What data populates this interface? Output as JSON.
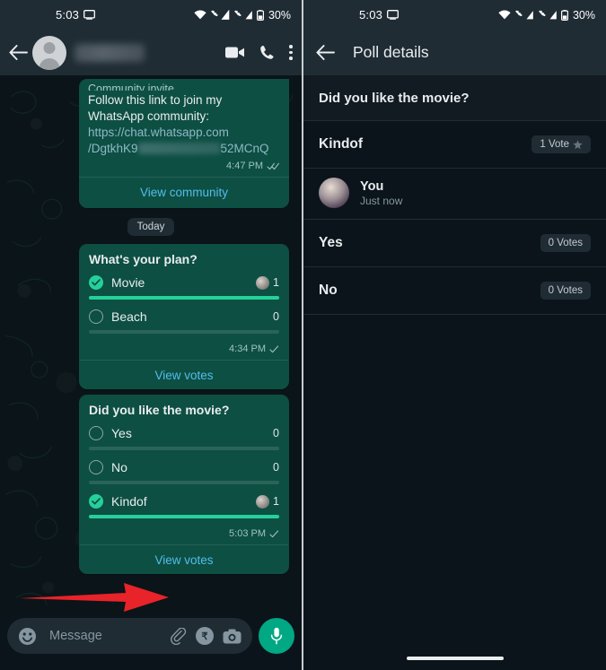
{
  "statusbar": {
    "time": "5:03",
    "battery_percent": "30%",
    "icons": [
      "screencast-icon",
      "wifi-icon",
      "cellular-signal-icon",
      "cellular-signal-icon",
      "battery-icon"
    ]
  },
  "left_panel": {
    "header": {
      "back_icon": "back-arrow-icon",
      "avatar": "contact-avatar",
      "contact_name": "",
      "actions": [
        "video-call-icon",
        "voice-call-icon",
        "overflow-menu-icon"
      ]
    },
    "messages": [
      {
        "type": "community_invite",
        "label": "Community invite",
        "text_line1": "Follow this link to join my",
        "text_line2": "WhatsApp community:",
        "link_line1": "https://chat.whatsapp.com",
        "link_line2_prefix": "/DgtkhK9",
        "link_line2_suffix": "52MCnQ",
        "time": "4:47 PM",
        "status": "read-receipt-double-check",
        "action": "View community"
      }
    ],
    "day_divider": "Today",
    "polls": [
      {
        "question": "What's your plan?",
        "options": [
          {
            "label": "Movie",
            "count": "1",
            "selected": true,
            "percent": 100,
            "has_voter_avatar": true
          },
          {
            "label": "Beach",
            "count": "0",
            "selected": false,
            "percent": 0,
            "has_voter_avatar": false
          }
        ],
        "time": "4:34 PM",
        "status": "sent-single-check",
        "action": "View votes"
      },
      {
        "question": "Did you like the movie?",
        "options": [
          {
            "label": "Yes",
            "count": "0",
            "selected": false,
            "percent": 0,
            "has_voter_avatar": false
          },
          {
            "label": "No",
            "count": "0",
            "selected": false,
            "percent": 0,
            "has_voter_avatar": false
          },
          {
            "label": "Kindof",
            "count": "1",
            "selected": true,
            "percent": 100,
            "has_voter_avatar": true
          }
        ],
        "time": "5:03 PM",
        "status": "sent-single-check",
        "action": "View votes"
      }
    ],
    "input_bar": {
      "emoji_icon": "emoji-smiley-icon",
      "placeholder": "Message",
      "attach_icon": "paperclip-icon",
      "payment_icon": "rupee-payment-icon",
      "camera_icon": "camera-icon",
      "mic_icon": "microphone-icon"
    }
  },
  "right_panel": {
    "header": {
      "back_icon": "back-arrow-icon",
      "title": "Poll details"
    },
    "question": "Did you like the movie?",
    "results": [
      {
        "option": "Kindof",
        "badge": "1 Vote",
        "starred": true,
        "voters": [
          {
            "name": "You",
            "time": "Just now"
          }
        ]
      },
      {
        "option": "Yes",
        "badge": "0 Votes",
        "starred": false,
        "voters": []
      },
      {
        "option": "No",
        "badge": "0 Votes",
        "starred": false,
        "voters": []
      }
    ]
  },
  "annotation": {
    "arrow_color": "#e8232a",
    "points_to": "View votes"
  },
  "colors": {
    "app_bar": "#1f2c34",
    "chat_background": "#0b1418",
    "outgoing_bubble": "#0d4f43",
    "accent_green": "#00a884",
    "poll_bar_fill": "#25d19a",
    "link_blue": "#53bdeb",
    "panel_background": "#0b141a"
  }
}
